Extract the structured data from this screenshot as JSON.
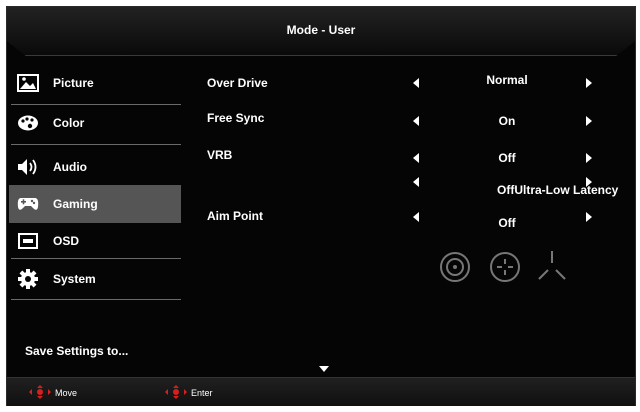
{
  "header": {
    "title": "Mode - User"
  },
  "sidebar": {
    "items": [
      {
        "label": "Picture",
        "icon": "picture-icon"
      },
      {
        "label": "Color",
        "icon": "palette-icon"
      },
      {
        "label": "Audio",
        "icon": "speaker-icon"
      },
      {
        "label": "Gaming",
        "icon": "gamepad-icon",
        "active": true
      },
      {
        "label": "OSD",
        "icon": "osd-icon"
      },
      {
        "label": "System",
        "icon": "gear-icon"
      }
    ],
    "save_label": "Save Settings to..."
  },
  "settings": [
    {
      "label": "Over Drive",
      "value": "Normal"
    },
    {
      "label": "Free Sync",
      "value": "On"
    },
    {
      "label": "VRB",
      "value": "Off"
    },
    {
      "label": "",
      "value": "OffUltra-Low Latency"
    },
    {
      "label": "Aim Point",
      "value": "Off"
    }
  ],
  "footer": {
    "move_label": "Move",
    "enter_label": "Enter"
  },
  "colors": {
    "background": "#050505",
    "active": "#555555",
    "accent_red": "#d81e1e"
  }
}
